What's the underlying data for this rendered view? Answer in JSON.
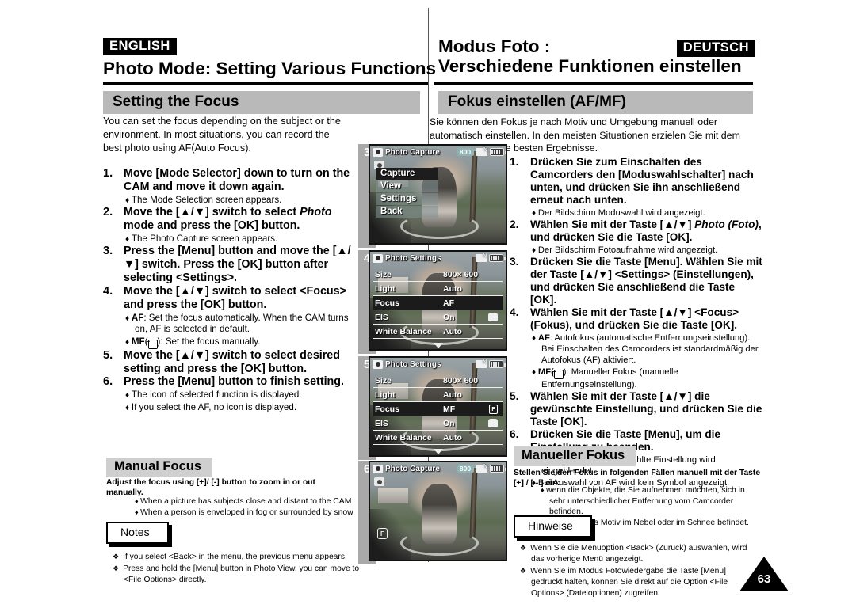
{
  "english": {
    "lang_badge": "ENGLISH",
    "title": "Photo Mode: Setting Various Functions",
    "section_header": "Setting the Focus",
    "intro": "You can set the focus depending on the subject or the environment. In most situations, you can record the best photo using AF(Auto Focus).",
    "steps": [
      {
        "num": "1.",
        "text": "Move [Mode Selector] down to turn on the CAM and move it down again.",
        "bullets": [
          "The Mode Selection screen appears."
        ]
      },
      {
        "num": "2.",
        "text_pre": "Move the [▲/▼] switch to select ",
        "text_ital": "Photo",
        "text_post": " mode and press the [OK] button.",
        "bullets": [
          "The Photo Capture screen appears."
        ]
      },
      {
        "num": "3.",
        "text": "Press the [Menu] button and move the [▲/▼] switch. Press the [OK] button after selecting <Settings>.",
        "bullets": []
      },
      {
        "num": "4.",
        "text": "Move the [▲/▼] switch to select <Focus> and press the [OK] button.",
        "bullets": [
          "AF: Set the focus automatically. When the CAM turns on, AF is selected in default.",
          "MF(  ): Set the focus manually."
        ]
      },
      {
        "num": "5.",
        "text": "Move the [▲/▼] switch to select desired setting and press the [OK] button.",
        "bullets": []
      },
      {
        "num": "6.",
        "text": "Press the [Menu] button to finish setting.",
        "bullets": [
          "The icon of selected function is displayed.",
          "If you select the AF, no icon is displayed."
        ]
      }
    ],
    "sub_header": "Manual Focus",
    "sub_intro": "Adjust the focus using [+]/ [-] button to zoom in or out manually.",
    "sub_bullets": [
      "When a picture has subjects close and distant to  the CAM",
      "When a person is enveloped in fog or surrounded by snow"
    ],
    "notes_title": "Notes",
    "notes": [
      "If you select <Back> in the menu, the previous menu appears.",
      "Press and hold the [Menu] button in Photo View, you can move to <File Options> directly."
    ]
  },
  "german": {
    "lang_badge": "DEUTSCH",
    "title_line1": "Modus Foto :",
    "title_line2": "Verschiedene Funktionen einstellen",
    "section_header": "Fokus einstellen (AF/MF)",
    "intro": "Sie können den Fokus je nach Motiv und Umgebung manuell oder automatisch einstellen. In den meisten Situationen erzielen Sie mit dem Autofokus (AF) die besten Ergebnisse.",
    "steps": [
      {
        "num": "1.",
        "text": "Drücken Sie zum Einschalten des Camcorders den [Moduswahlschalter] nach unten, und drücken Sie ihn anschließend erneut nach unten.",
        "bullets": [
          "Der Bildschirm Moduswahl wird angezeigt."
        ]
      },
      {
        "num": "2.",
        "text_pre": "Wählen Sie mit der Taste [▲/▼] ",
        "text_ital": "Photo (Foto)",
        "text_post": ", und drücken Sie die Taste [OK].",
        "bullets": [
          "Der Bildschirm Fotoaufnahme wird angezeigt."
        ]
      },
      {
        "num": "3.",
        "text": "Drücken Sie die Taste [Menu]. Wählen Sie mit der Taste [▲/▼] <Settings> (Einstellungen), und drücken Sie anschließend die Taste [OK].",
        "bullets": []
      },
      {
        "num": "4.",
        "text": "Wählen Sie mit der Taste [▲/▼] <Focus> (Fokus), und drücken Sie die Taste [OK].",
        "bullets": [
          "AF: Autofokus (automatische Entfernungseinstellung). Bei Einschalten des Camcorders ist standardmäßig der Autofokus (AF) aktiviert.",
          "MF(  ): Manueller Fokus (manuelle Entfernungseinstellung)."
        ]
      },
      {
        "num": "5.",
        "text": "Wählen Sie mit der Taste [▲/▼] die gewünschte Einstellung, und drücken Sie die Taste [OK].",
        "bullets": []
      },
      {
        "num": "6.",
        "text": "Drücken Sie die Taste [Menu], um die Einstellung zu beenden.",
        "bullets": [
          "Das Symbol für die gewählte Einstellung wird eingeblendet.",
          "Bei Auswahl von AF wird kein Symbol angezeigt."
        ]
      }
    ],
    "sub_header": "Manueller Fokus",
    "sub_intro": "Stellen Sie den Fokus in folgenden Fällen manuell mit der Taste [+] / [ - ] ein:",
    "sub_bullets": [
      "wenn die Objekte, die Sie aufnehmen möchten, sich in sehr unterschiedlicher Entfernung vom Camcorder befinden.",
      "wenn sich das Motiv im Nebel oder im Schnee befindet."
    ],
    "notes_title": "Hinweise",
    "notes": [
      "Wenn Sie die Menüoption <Back> (Zurück) auswählen, wird das vorherige Menü angezeigt.",
      "Wenn Sie im Modus Fotowiedergabe die Taste [Menu]  gedrückt halten, können Sie direkt auf die Option <File Options> (Dateioptionen) zugreifen."
    ]
  },
  "lcd_screens": [
    {
      "step_number": "3",
      "osd_title": "Photo Capture",
      "osd_counter": "800",
      "type": "popup-menu",
      "menu_items": [
        {
          "label": "Capture",
          "selected": true
        },
        {
          "label": "View",
          "selected": false
        },
        {
          "label": "Settings",
          "selected": false
        },
        {
          "label": "Back",
          "selected": false
        }
      ]
    },
    {
      "step_number": "4",
      "osd_title": "Photo Settings",
      "osd_counter": "",
      "type": "settings-list",
      "rows": [
        {
          "label": "Size",
          "value": "800× 600",
          "selected": false,
          "icon": ""
        },
        {
          "label": "Light",
          "value": "Auto",
          "selected": false,
          "icon": ""
        },
        {
          "label": "Focus",
          "value": "AF",
          "selected": true,
          "icon": ""
        },
        {
          "label": "EIS",
          "value": "On",
          "selected": false,
          "icon": "hand-icon"
        },
        {
          "label": "White Balance",
          "value": "Auto",
          "selected": false,
          "icon": ""
        }
      ]
    },
    {
      "step_number": "5",
      "osd_title": "Photo Settings",
      "osd_counter": "",
      "type": "settings-list",
      "rows": [
        {
          "label": "Size",
          "value": "800× 600",
          "selected": false,
          "icon": ""
        },
        {
          "label": "Light",
          "value": "Auto",
          "selected": false,
          "icon": ""
        },
        {
          "label": "Focus",
          "value": "MF",
          "selected": true,
          "icon": "mf-icon"
        },
        {
          "label": "EIS",
          "value": "On",
          "selected": false,
          "icon": "hand-icon"
        },
        {
          "label": "White Balance",
          "value": "Auto",
          "selected": false,
          "icon": ""
        }
      ]
    },
    {
      "step_number": "6",
      "osd_title": "Photo Capture",
      "osd_counter": "800",
      "type": "preview",
      "menu_items": []
    }
  ],
  "page_number": "63",
  "colors": {
    "section_bar": "#b9b9b9",
    "subhead_bar": "#cfcfcf",
    "badge_bg": "#000000",
    "lcd_selected": "#1b1b1b",
    "osd_counter_bg": "#8fb3b3"
  }
}
